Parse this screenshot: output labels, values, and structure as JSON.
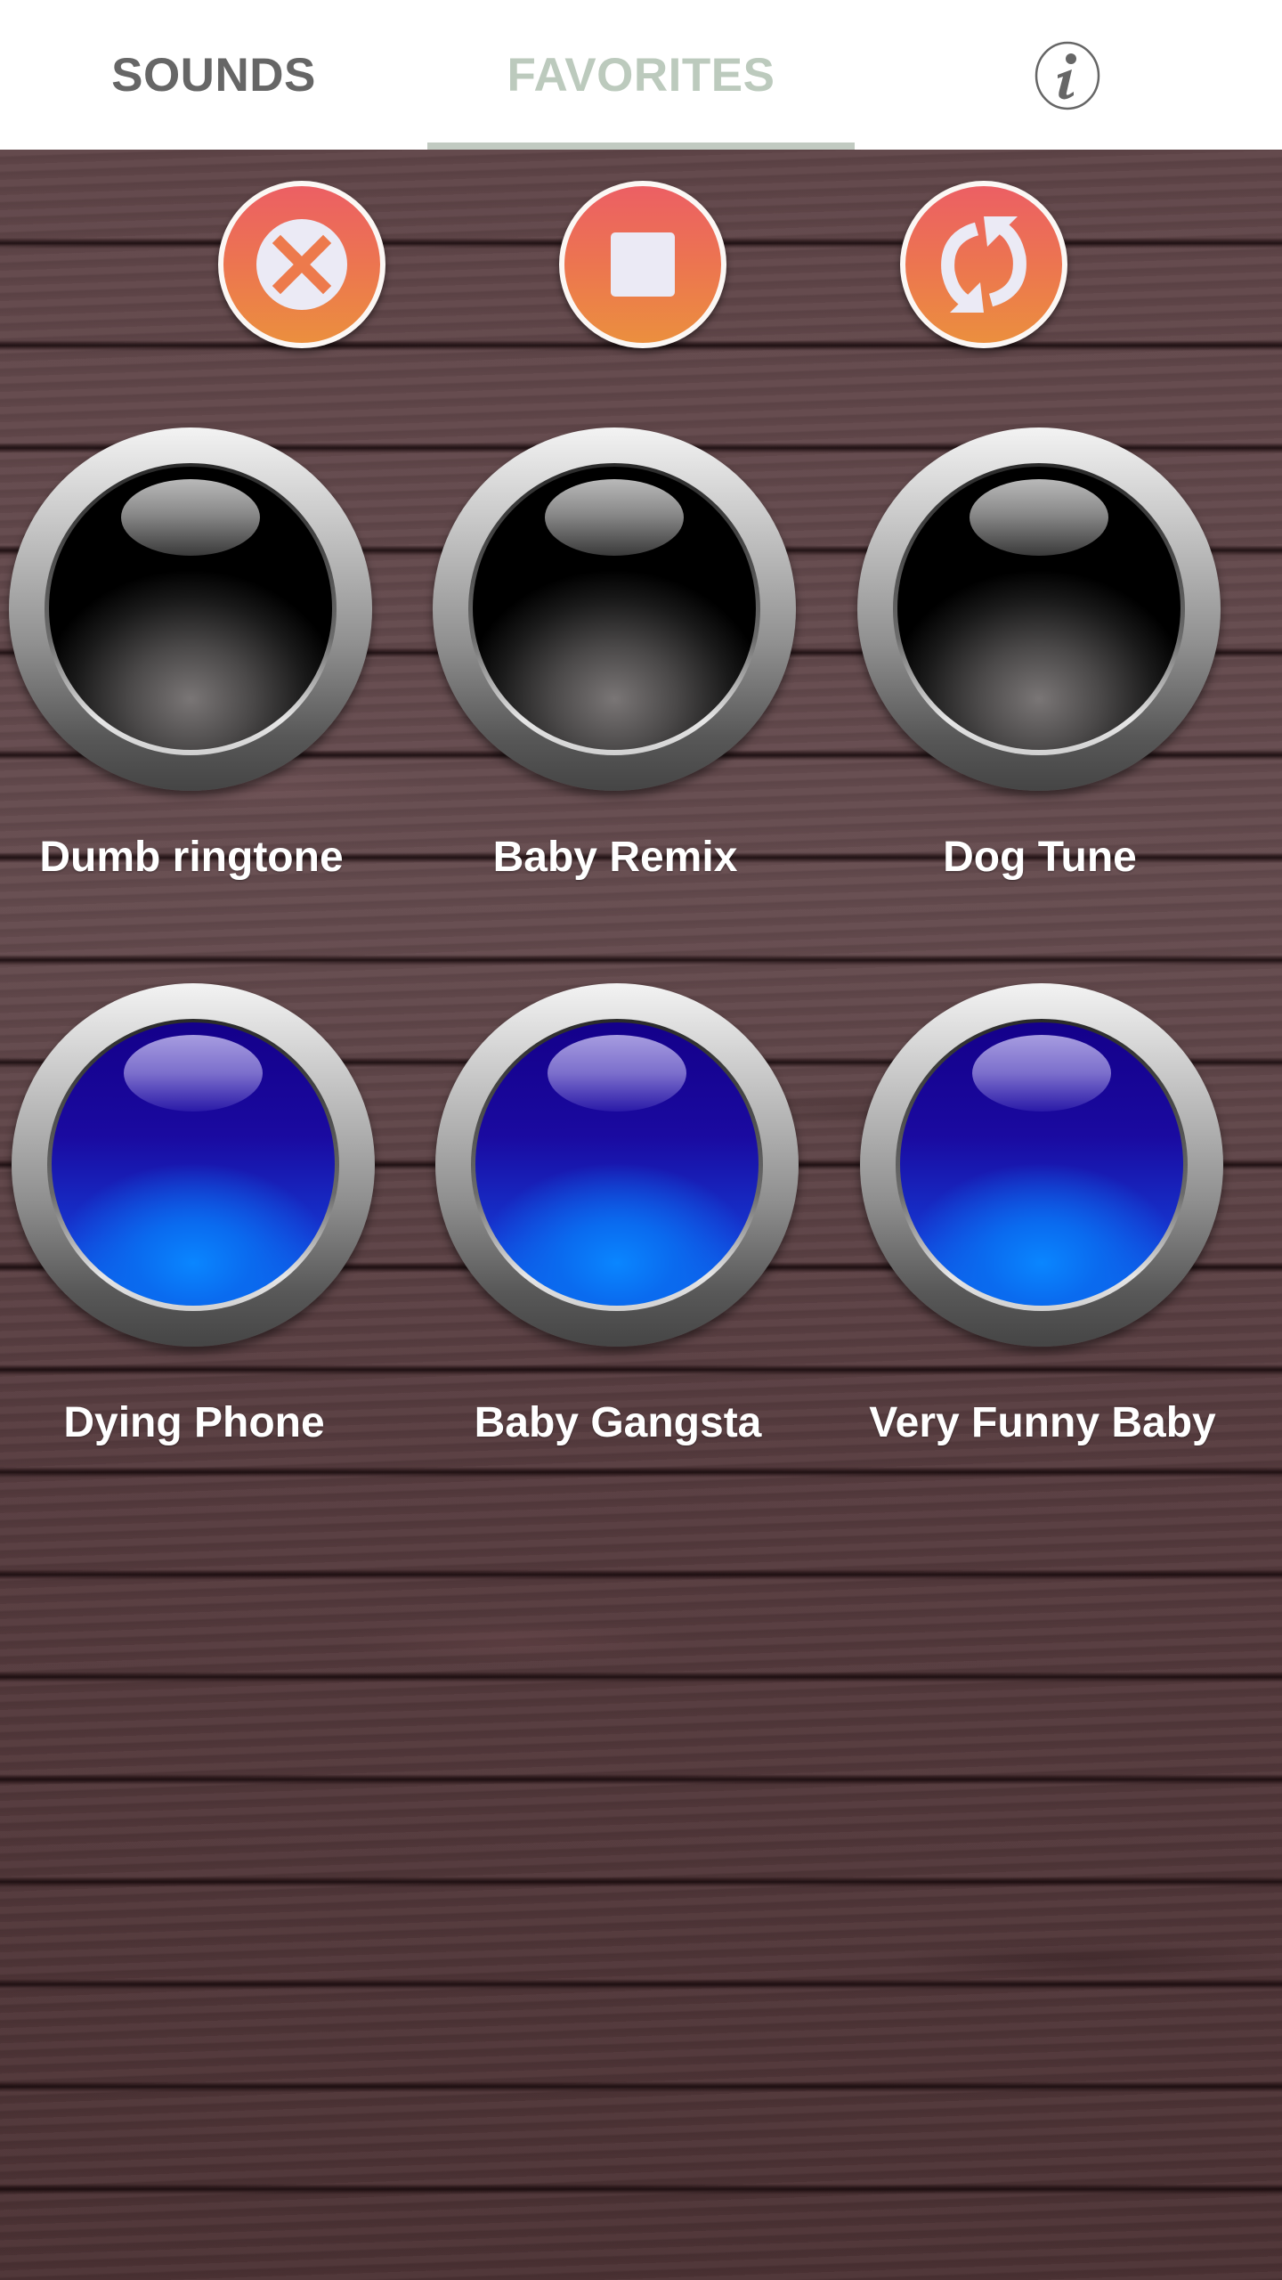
{
  "tabs": [
    {
      "label": "SOUNDS",
      "active": false
    },
    {
      "label": "FAVORITES",
      "active": true
    }
  ],
  "header": {
    "info_icon": "info-icon"
  },
  "controls": [
    {
      "name": "cancel",
      "icon": "close-circle-icon"
    },
    {
      "name": "stop",
      "icon": "stop-icon"
    },
    {
      "name": "repeat",
      "icon": "repeat-icon"
    }
  ],
  "sounds": [
    {
      "label": "Dumb ringtone",
      "style": "black"
    },
    {
      "label": "Baby Remix",
      "style": "black"
    },
    {
      "label": "Dog Tune",
      "style": "black"
    },
    {
      "label": "Dying Phone",
      "style": "blue"
    },
    {
      "label": "Baby Gangsta",
      "style": "blue"
    },
    {
      "label": "Very Funny Baby",
      "style": "blue"
    }
  ],
  "colors": {
    "tab_inactive": "#666666",
    "tab_active": "#bccabd",
    "tab_indicator": "#c1cac1",
    "control_gradient_top": "#ec5f64",
    "control_gradient_bottom": "#eb8f3e",
    "control_icon": "#ebeaf5",
    "wood": "#5a4043"
  }
}
